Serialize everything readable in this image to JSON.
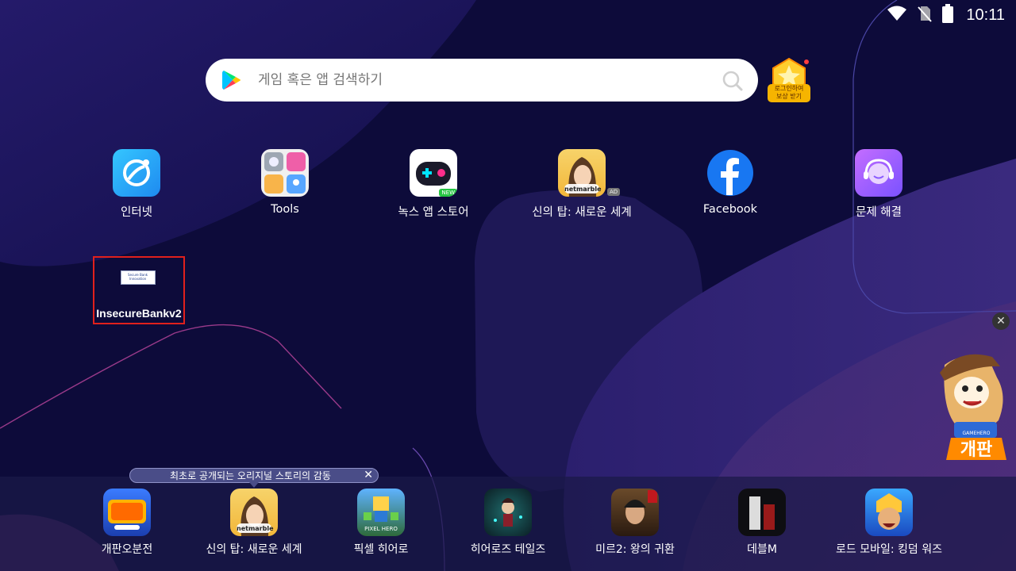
{
  "status_bar": {
    "time": "10:11",
    "icons": [
      "wifi-icon",
      "no-sim-icon",
      "battery-icon"
    ]
  },
  "search": {
    "placeholder": "게임 혹은 앱 검색하기"
  },
  "reward": {
    "label_line1": "로그인하여",
    "label_line2": "보상 받기"
  },
  "apps": [
    {
      "label": "인터넷",
      "icon": "internet-icon"
    },
    {
      "label": "Tools",
      "icon": "tools-icon"
    },
    {
      "label": "녹스 앱 스토어",
      "icon": "nox-app-store-icon",
      "badge": "NEW"
    },
    {
      "label": "신의 탑: 새로운 세계",
      "icon": "tower-of-god-icon",
      "badge": "AD",
      "brand": "netmarble"
    },
    {
      "label": "Facebook",
      "icon": "facebook-icon"
    },
    {
      "label": "문제 해결",
      "icon": "help-icon"
    }
  ],
  "selected_app": {
    "label": "InsecureBankv2",
    "logo_text_1": "Secure Bank",
    "logo_text_2": "Innovation"
  },
  "dock_tooltip": {
    "text": "최초로 공개되는 오리지널 스토리의 감동",
    "close": "✕"
  },
  "dock": [
    {
      "label": "개판오분전",
      "icon": "gaepan-icon"
    },
    {
      "label": "신의 탑: 새로운 세계",
      "icon": "tower-of-god-icon",
      "brand": "netmarble"
    },
    {
      "label": "픽셀 히어로",
      "icon": "pixel-hero-icon",
      "brand": "PIXEL HERO"
    },
    {
      "label": "히어로즈 테일즈",
      "icon": "heroes-tales-icon"
    },
    {
      "label": "미르2: 왕의 귀환",
      "icon": "mir2-icon"
    },
    {
      "label": "데블M",
      "icon": "devil-m-icon"
    },
    {
      "label": "로드 모바일: 킹덤 워즈",
      "icon": "lords-mobile-icon"
    }
  ],
  "floating_ad": {
    "close": "✕",
    "title": "개판",
    "brand": "GAMEHERO"
  },
  "colors": {
    "background": "#0d0b3a",
    "search_bg": "#ffffff",
    "selection_border": "#e0201c",
    "facebook": "#1877f2"
  }
}
